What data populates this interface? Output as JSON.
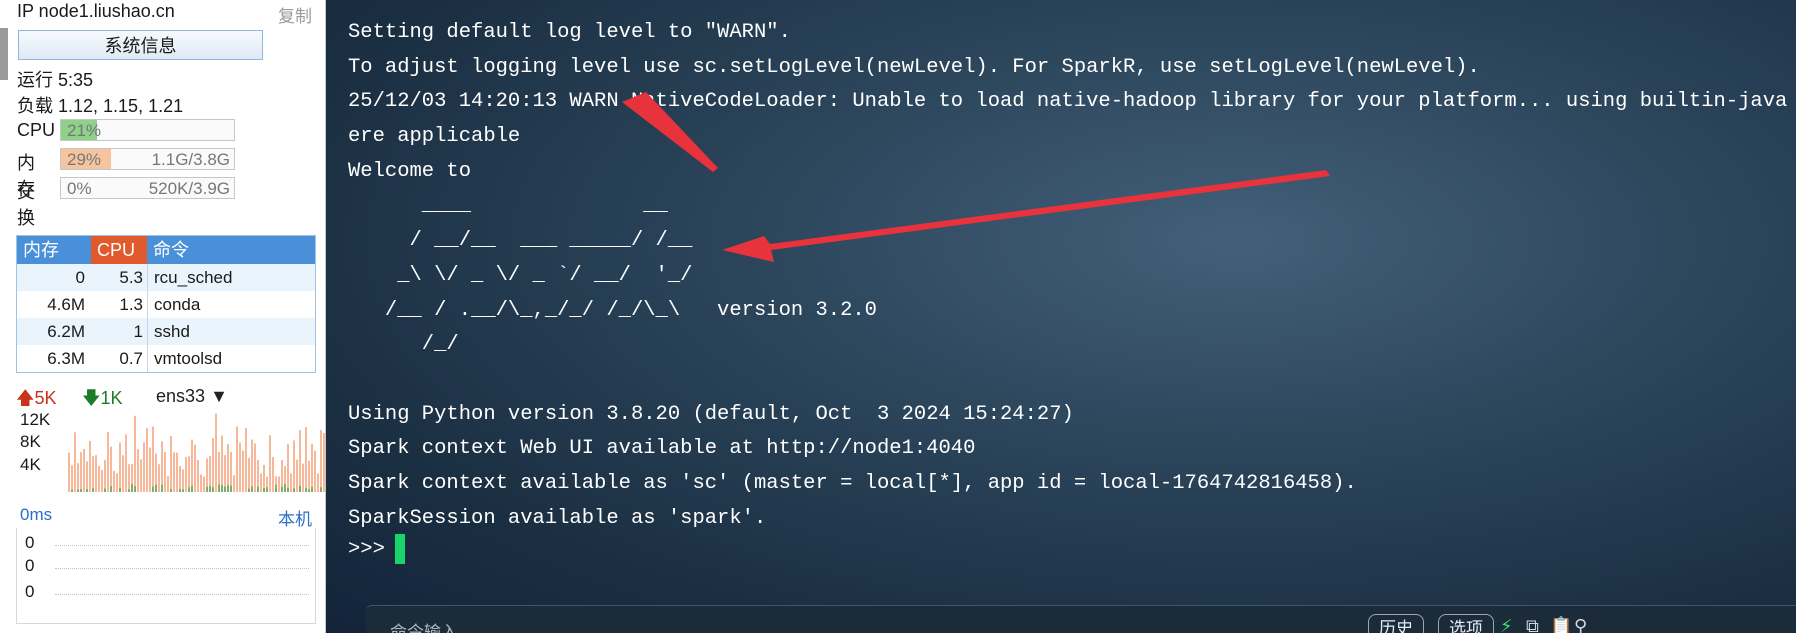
{
  "sidebar": {
    "ip_label": "IP node1.liushao.cn",
    "copy_label": "复制",
    "sysinfo_button": "系统信息",
    "uptime": "运行 5:35",
    "load": "负载 1.12, 1.15, 1.21",
    "cpu": {
      "label": "CPU",
      "percent": "21%",
      "fraction": 0.21,
      "color": "#8fd08a"
    },
    "memory": {
      "label": "内存",
      "percent": "29%",
      "value": "1.1G/3.8G",
      "fraction": 0.29,
      "color": "#f6c49e"
    },
    "swap": {
      "label": "交换",
      "percent": "0%",
      "value": "520K/3.9G",
      "fraction": 0.0,
      "color": "#cccccc"
    },
    "process_table": {
      "headers": {
        "mem": "内存",
        "cpu": "CPU",
        "cmd": "命令"
      },
      "rows": [
        {
          "mem": "0",
          "cpu": "5.3",
          "cmd": "rcu_sched"
        },
        {
          "mem": "4.6M",
          "cpu": "1.3",
          "cmd": "conda"
        },
        {
          "mem": "6.2M",
          "cpu": "1",
          "cmd": "sshd"
        },
        {
          "mem": "6.3M",
          "cpu": "0.7",
          "cmd": "vmtoolsd"
        }
      ]
    },
    "network": {
      "up": "5K",
      "down": "1K",
      "interface": "ens33",
      "up_icon": "arrow-up-icon",
      "down_icon": "arrow-down-icon",
      "chart_ticks": [
        "12K",
        "8K",
        "4K"
      ]
    },
    "ping": {
      "latency": "0ms",
      "target": "本机",
      "values": [
        "0",
        "0",
        "0"
      ]
    }
  },
  "terminal": {
    "lines": [
      "Setting default log level to \"WARN\".",
      "To adjust logging level use sc.setLogLevel(newLevel). For SparkR, use setLogLevel(newLevel).",
      "25/12/03 14:20:13 WARN NativeCodeLoader: Unable to load native-hadoop library for your platform... using builtin-java classes wh",
      "ere applicable",
      "Welcome to",
      "      ____              __",
      "     / __/__  ___ _____/ /__",
      "    _\\ \\/ _ \\/ _ `/ __/  '_/",
      "   /__ / .__/\\_,_/_/ /_/\\_\\   version 3.2.0",
      "      /_/",
      "",
      "Using Python version 3.8.20 (default, Oct  3 2024 15:24:27)",
      "Spark context Web UI available at http://node1:4040",
      "Spark context available as 'sc' (master = local[*], app id = local-1764742816458).",
      "SparkSession available as 'spark'."
    ],
    "prompt": ">>>",
    "annotation_color": "#e8323c"
  },
  "command_bar": {
    "placeholder": "命令输入",
    "history_button": "历史",
    "options_button": "选项",
    "icons": [
      "lightning-icon",
      "copy-icon",
      "paste-icon",
      "search-icon"
    ]
  }
}
